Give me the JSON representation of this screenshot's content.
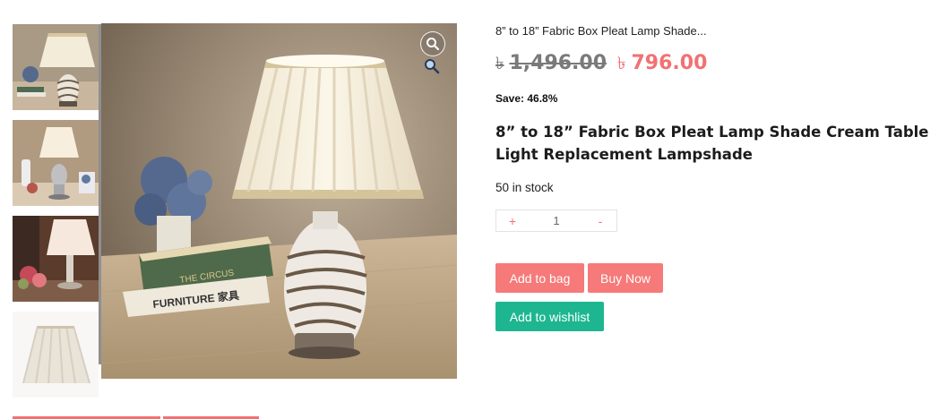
{
  "product": {
    "breadcrumb_title": "8” to 18” Fabric Box Pleat Lamp Shade...",
    "currency_symbol": "৳",
    "old_price": "1,496.00",
    "new_price": "796.00",
    "save_text": "Save: 46.8%",
    "title": "8” to 18” Fabric Box Pleat Lamp Shade Cream Table Light Replacement Lampshade",
    "stock": "50 in stock"
  },
  "quantity": {
    "plus": "+",
    "value": "1",
    "minus": "-"
  },
  "actions": {
    "add_to_bag": "Add to bag",
    "buy_now": "Buy Now",
    "add_to_wishlist": "Add to wishlist"
  },
  "gallery": {
    "thumbnails": [
      "lamp-thumb-1",
      "lamp-thumb-2",
      "lamp-thumb-3",
      "lamp-thumb-4"
    ],
    "zoom_icon": "search-icon"
  },
  "colors": {
    "accent": "#f27173",
    "button": "#f57a79",
    "wishlist": "#1db690"
  }
}
